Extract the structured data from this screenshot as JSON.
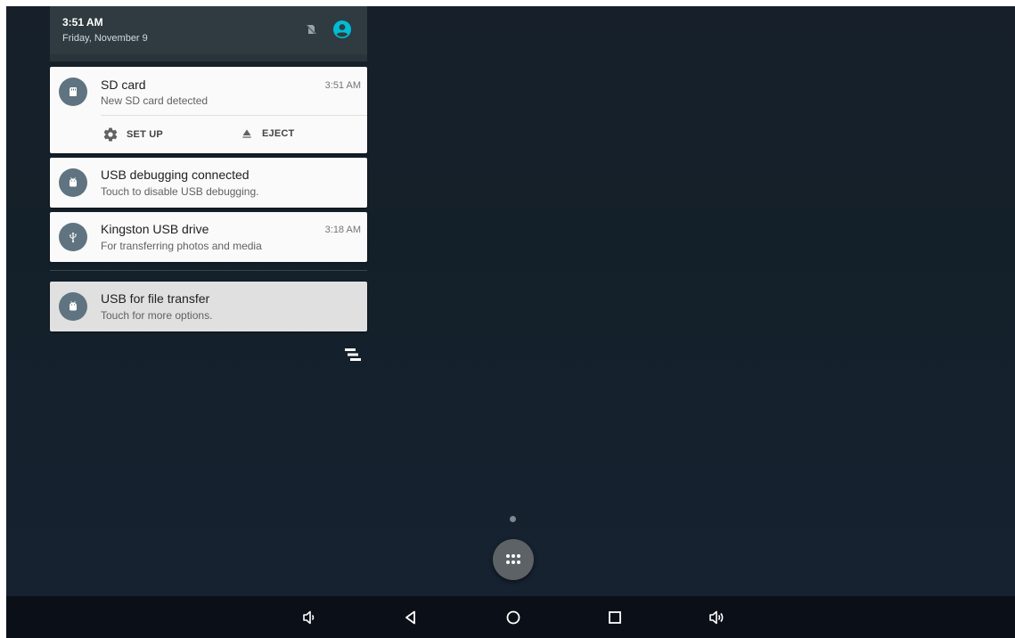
{
  "header": {
    "time": "3:51 AM",
    "date": "Friday, November 9",
    "icons": [
      "no-sim-icon",
      "account-icon"
    ],
    "accent_color": "#00bcd4"
  },
  "notifications": [
    {
      "title": "SD card",
      "text": "New SD card detected",
      "time": "3:51 AM",
      "icon": "sd-card-icon",
      "actions": [
        {
          "label": "SET UP",
          "icon": "gear-icon"
        },
        {
          "label": "EJECT",
          "icon": "eject-icon"
        }
      ]
    },
    {
      "title": "USB debugging connected",
      "text": "Touch to disable USB debugging.",
      "icon": "android-icon"
    },
    {
      "title": "Kingston USB drive",
      "text": "For transferring photos and media",
      "time": "3:18 AM",
      "icon": "usb-icon"
    },
    {
      "title": "USB for file transfer",
      "text": "Touch for more options.",
      "icon": "android-icon"
    }
  ],
  "navbar": {
    "buttons": [
      "volume-down-icon",
      "back-icon",
      "home-icon",
      "recents-icon",
      "volume-up-icon"
    ]
  }
}
